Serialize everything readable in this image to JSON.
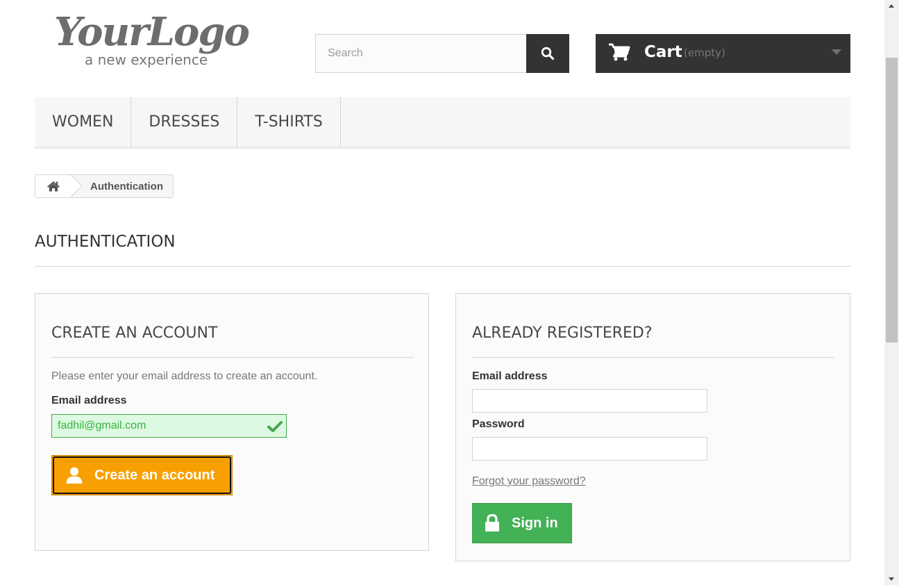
{
  "header": {
    "logo_main": "YourLogo",
    "logo_sub": "a new experience",
    "search_placeholder": "Search",
    "search_icon": "search-icon",
    "cart_icon": "shopping-cart-icon",
    "cart_label": "Cart",
    "cart_status": "(empty)"
  },
  "menu": {
    "items": [
      {
        "label": "WOMEN"
      },
      {
        "label": "DRESSES"
      },
      {
        "label": "T-SHIRTS"
      }
    ]
  },
  "breadcrumb": {
    "home_icon": "home-icon",
    "current": "Authentication"
  },
  "page": {
    "heading": "AUTHENTICATION"
  },
  "create_account": {
    "title": "CREATE AN ACCOUNT",
    "description": "Please enter your email address to create an account.",
    "email_label": "Email address",
    "email_value": "fadhil@gmail.com",
    "email_status_icon": "checkmark-icon",
    "button_label": "Create an account",
    "button_icon": "user-icon"
  },
  "login": {
    "title": "ALREADY REGISTERED?",
    "email_label": "Email address",
    "email_value": "",
    "password_label": "Password",
    "password_value": "",
    "forgot_link": "Forgot your password?",
    "button_label": "Sign in",
    "button_icon": "lock-icon"
  },
  "colors": {
    "dark": "#333333",
    "create_button": "#f8a001",
    "signin_button": "#43b155",
    "valid_field_bg": "#ddf9e1",
    "valid_field_text": "#35b33f"
  }
}
